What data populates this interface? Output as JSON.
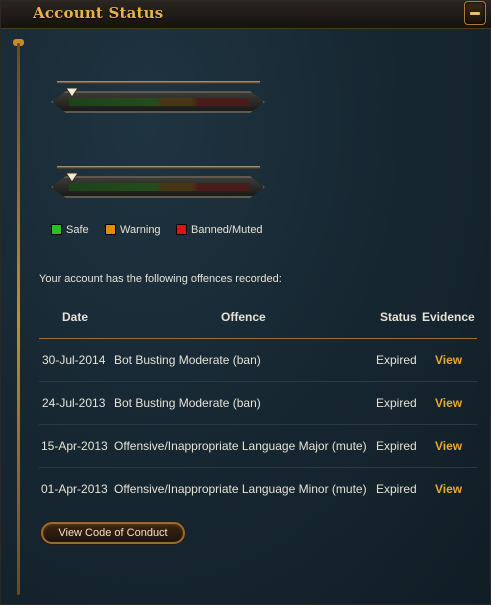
{
  "header": {
    "title": "Account Status"
  },
  "meters": [
    {
      "level": 0.04
    },
    {
      "level": 0.04
    }
  ],
  "legend": {
    "items": [
      {
        "label": "Safe",
        "color": "#2bbd2b"
      },
      {
        "label": "Warning",
        "color": "#e08a12"
      },
      {
        "label": "Banned/Muted",
        "color": "#d01818"
      }
    ]
  },
  "intro_text": "Your account has the following offences recorded:",
  "table": {
    "headers": {
      "date": "Date",
      "offence": "Offence",
      "status": "Status",
      "evidence": "Evidence"
    },
    "rows": [
      {
        "date": "30-Jul-2014",
        "offence": "Bot Busting Moderate (ban)",
        "status": "Expired",
        "evidence": "View"
      },
      {
        "date": "24-Jul-2013",
        "offence": "Bot Busting Moderate (ban)",
        "status": "Expired",
        "evidence": "View"
      },
      {
        "date": "15-Apr-2013",
        "offence": "Offensive/Inappropriate Language Major (mute)",
        "status": "Expired",
        "evidence": "View"
      },
      {
        "date": "01-Apr-2013",
        "offence": "Offensive/Inappropriate Language Minor (mute)",
        "status": "Expired",
        "evidence": "View"
      }
    ]
  },
  "code_of_conduct_button": "View Code of Conduct",
  "colors": {
    "accent": "#e6a930",
    "title": "#e9b14a",
    "background": "#172833"
  }
}
